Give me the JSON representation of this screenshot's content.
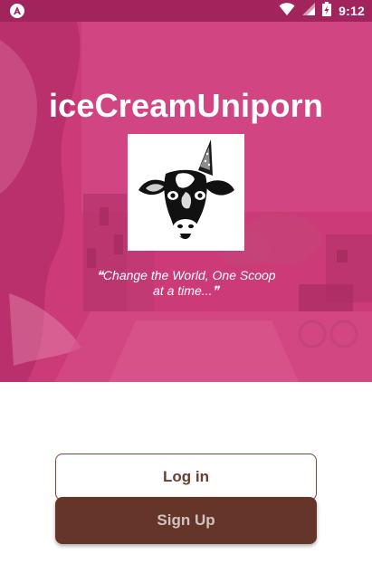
{
  "status_bar": {
    "time": "9:12",
    "icons": [
      "app-notification-icon",
      "wifi-icon",
      "cell-signal-icon",
      "battery-icon"
    ],
    "background_color": "#a1245c"
  },
  "hero": {
    "title": "iceCreamUniporn",
    "logo": "unicorn-cow-logo",
    "tagline": "❝Change the World, One Scoop at a time...❞",
    "overlay_color": "#d13a7c"
  },
  "actions": {
    "login_label": "Log in",
    "signup_label": "Sign Up",
    "brand_brown": "#643528"
  }
}
